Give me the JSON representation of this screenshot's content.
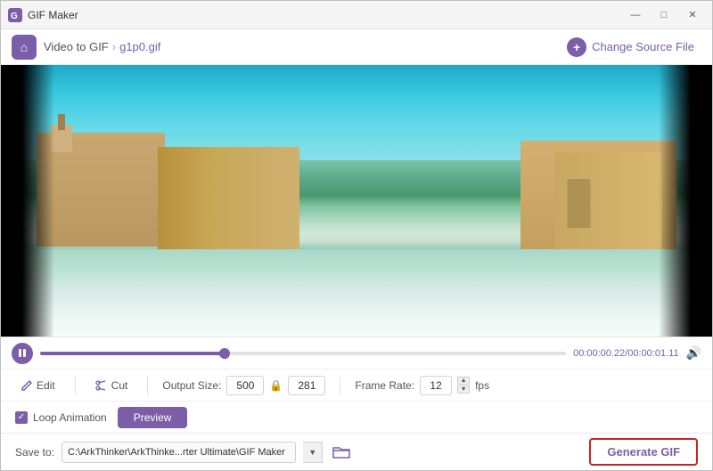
{
  "window": {
    "title": "GIF Maker",
    "min_label": "—",
    "max_label": "□",
    "close_label": "✕"
  },
  "nav": {
    "breadcrumb_parent": "Video to GIF",
    "breadcrumb_sep": "›",
    "breadcrumb_current": "g1p0.gif",
    "change_source_label": "Change Source File",
    "home_icon": "⌂"
  },
  "controls": {
    "time_current": "00:00:00.22",
    "time_total": "00:00:01.11",
    "time_sep": "/",
    "progress_percent": 35
  },
  "toolbar": {
    "edit_label": "Edit",
    "cut_label": "Cut",
    "output_size_label": "Output Size:",
    "output_width": "500",
    "output_height": "281",
    "frame_rate_label": "Frame Rate:",
    "frame_rate_value": "12",
    "fps_label": "fps"
  },
  "options": {
    "loop_label": "Loop Animation",
    "preview_label": "Preview"
  },
  "save": {
    "save_to_label": "Save to:",
    "save_path": "C:\\ArkThinker\\ArkThinke...rter Ultimate\\GIF Maker",
    "generate_label": "Generate GIF"
  }
}
